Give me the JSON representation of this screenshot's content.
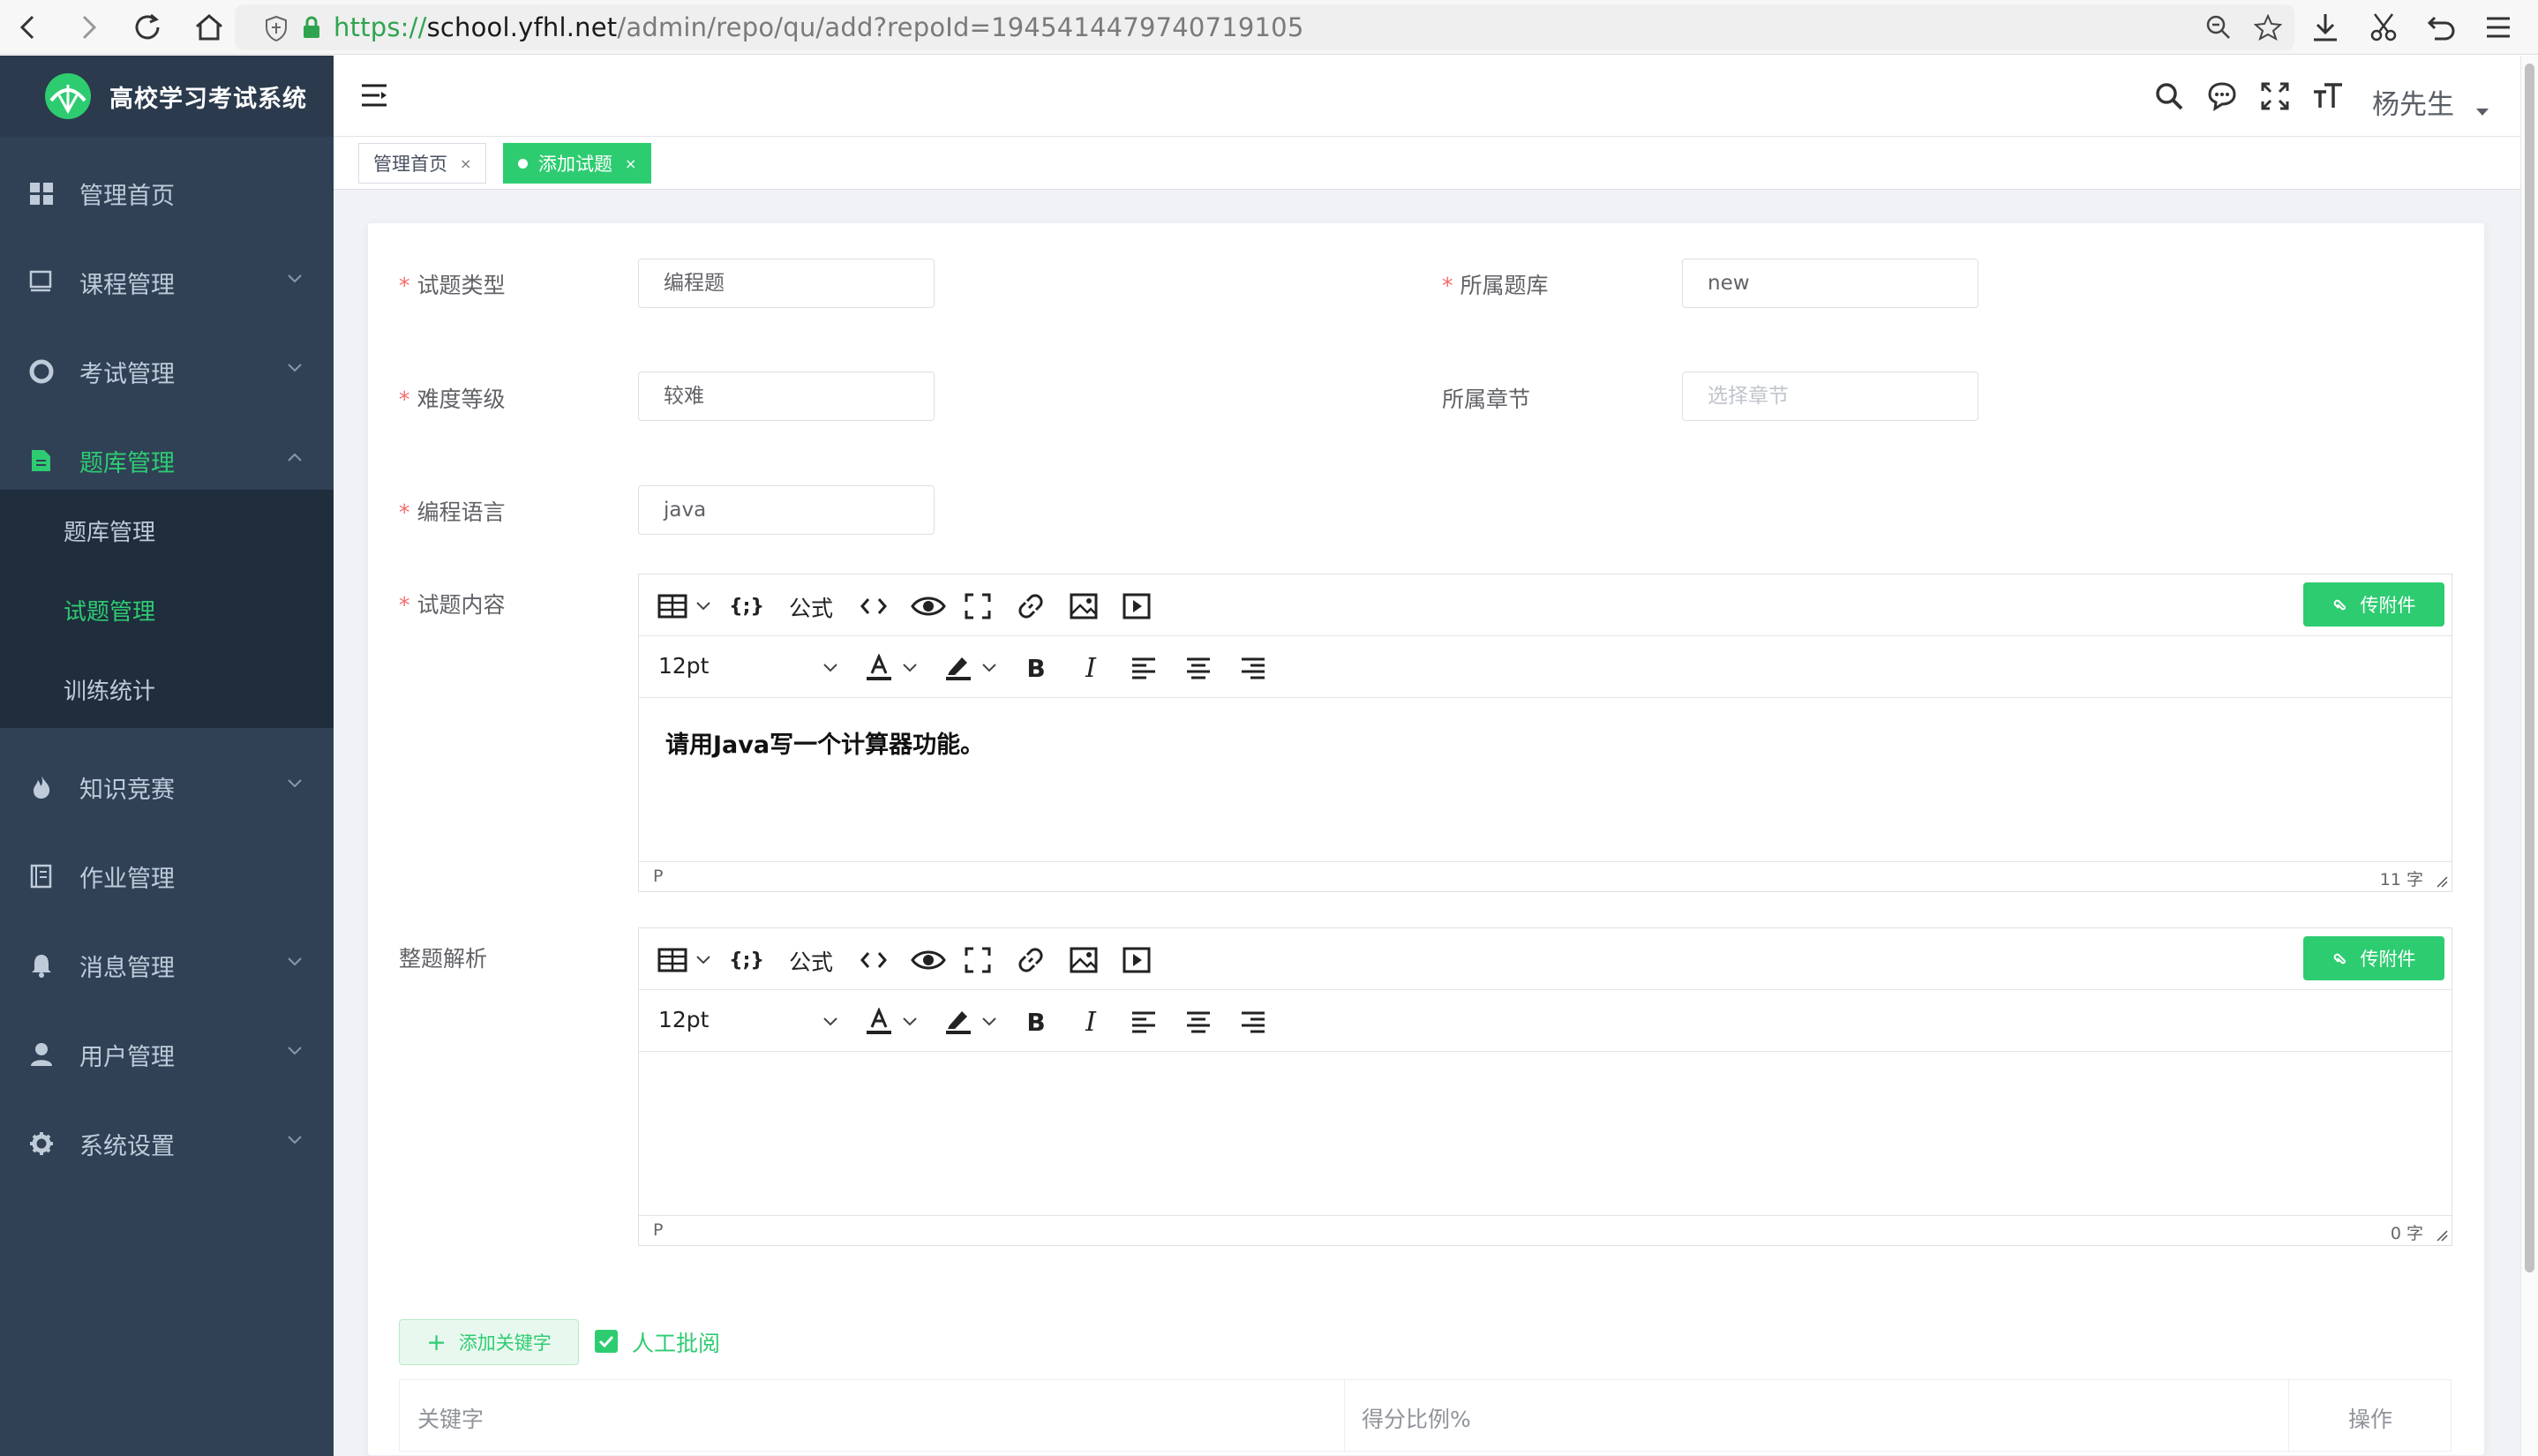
{
  "browser": {
    "url_scheme": "https://",
    "url_host": "school.yfhl.net",
    "url_path": "/admin/repo/qu/add?repoId=1945414479740719105"
  },
  "app": {
    "title": "高校学习考试系统"
  },
  "sidebar": {
    "items": [
      {
        "label": "管理首页",
        "icon": "dashboard-icon"
      },
      {
        "label": "课程管理",
        "icon": "monitor-icon"
      },
      {
        "label": "考试管理",
        "icon": "lifebuoy-icon"
      },
      {
        "label": "题库管理",
        "icon": "document-icon"
      },
      {
        "label": "知识竞赛",
        "icon": "fire-icon"
      },
      {
        "label": "作业管理",
        "icon": "book-icon"
      },
      {
        "label": "消息管理",
        "icon": "bell-icon"
      },
      {
        "label": "用户管理",
        "icon": "user-icon"
      },
      {
        "label": "系统设置",
        "icon": "gear-icon"
      }
    ],
    "sub_items": [
      {
        "label": "题库管理"
      },
      {
        "label": "试题管理"
      },
      {
        "label": "训练统计"
      }
    ]
  },
  "header": {
    "user": "杨先生"
  },
  "tags": [
    {
      "label": "管理首页"
    },
    {
      "label": "添加试题"
    }
  ],
  "form": {
    "type_label": "试题类型",
    "type_value": "编程题",
    "repo_label": "所属题库",
    "repo_value": "new",
    "level_label": "难度等级",
    "level_value": "较难",
    "chapter_label": "所属章节",
    "chapter_placeholder": "选择章节",
    "lang_label": "编程语言",
    "lang_value": "java",
    "content_label": "试题内容",
    "analysis_label": "整题解析"
  },
  "editor": {
    "formula": "公式",
    "font_size": "12pt",
    "attach": "传附件",
    "path": "P"
  },
  "content_editor": {
    "text": "请用Java写一个计算器功能。",
    "word_count": "11 字"
  },
  "analysis_editor": {
    "text": "",
    "word_count": "0 字"
  },
  "keywords": {
    "add_button": "添加关键字",
    "manual_review": "人工批阅",
    "col_keyword": "关键字",
    "col_ratio": "得分比例%",
    "col_action": "操作"
  },
  "colors": {
    "accent": "#2ecc71",
    "sidebar": "#304156",
    "sidebar_sub": "#1f2d3d",
    "required": "#f56c6c"
  }
}
